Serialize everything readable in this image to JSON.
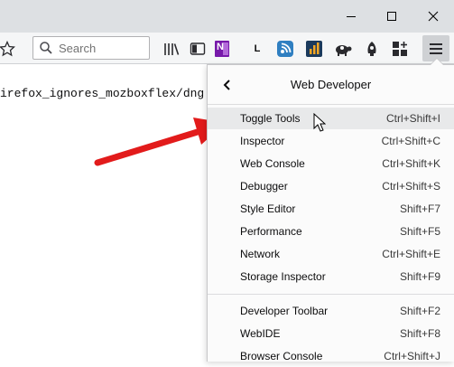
{
  "window": {
    "minimize_icon": "minimize-icon",
    "maximize_icon": "maximize-icon",
    "close_icon": "close-icon"
  },
  "toolbar": {
    "search_placeholder": "Search",
    "bookmark_icon": "star-icon",
    "onenote_badge": "N",
    "l_badge": "L",
    "icons": [
      "library-icon",
      "sidebar-icon",
      "onenote-icon",
      "l-extension-icon",
      "wifi-sync-icon",
      "analytics-icon",
      "turtle-icon",
      "alert-rocket-icon",
      "add-ons-icon",
      "hamburger-menu-icon"
    ]
  },
  "page": {
    "text": "irefox_ignores_mozboxflex/dng"
  },
  "panel": {
    "title": "Web Developer",
    "items": [
      {
        "label": "Toggle Tools",
        "shortcut": "Ctrl+Shift+I"
      },
      {
        "label": "Inspector",
        "shortcut": "Ctrl+Shift+C"
      },
      {
        "label": "Web Console",
        "shortcut": "Ctrl+Shift+K"
      },
      {
        "label": "Debugger",
        "shortcut": "Ctrl+Shift+S"
      },
      {
        "label": "Style Editor",
        "shortcut": "Shift+F7"
      },
      {
        "label": "Performance",
        "shortcut": "Shift+F5"
      },
      {
        "label": "Network",
        "shortcut": "Ctrl+Shift+E"
      },
      {
        "label": "Storage Inspector",
        "shortcut": "Shift+F9"
      },
      {
        "label": "Developer Toolbar",
        "shortcut": "Shift+F2"
      },
      {
        "label": "WebIDE",
        "shortcut": "Shift+F8"
      },
      {
        "label": "Browser Console",
        "shortcut": "Ctrl+Shift+J"
      }
    ]
  },
  "colors": {
    "arrow": "#e21b1b",
    "accent_hover": "#e8e9ea",
    "titlebar": "#dde0e3"
  }
}
